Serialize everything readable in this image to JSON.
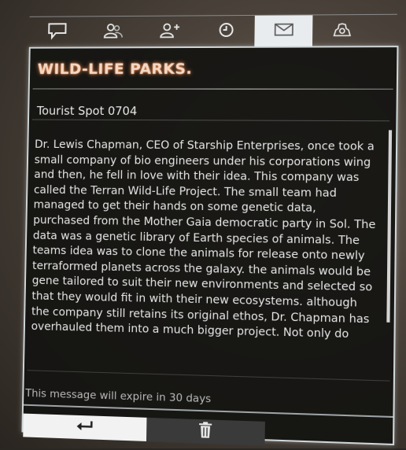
{
  "tabs": [
    {
      "icon": "chat-bubble-icon",
      "active": false
    },
    {
      "icon": "contacts-icon",
      "active": false
    },
    {
      "icon": "add-contact-icon",
      "active": false
    },
    {
      "icon": "clock-icon",
      "active": false
    },
    {
      "icon": "mail-icon",
      "active": true
    },
    {
      "icon": "settings-icon",
      "active": false
    }
  ],
  "message": {
    "title": "WILD-LIFE PARKS.",
    "subject": "Tourist Spot 0704",
    "body": "Dr. Lewis Chapman, CEO of Starship Enterprises, once took a small company of bio engineers under his corporations wing and then, he fell in love with their idea. This company was called the Terran Wild-Life Project. The small team had managed to get their hands on some genetic data, purchased from the Mother Gaia democratic party in Sol. The data was a genetic library of Earth species of animals. The teams idea was to clone the animals for release onto newly terraformed planets across the galaxy. the animals would be gene tailored to suit their new environments and selected so that they would fit in with their new ecosystems. although the company still retains its original ethos, Dr. Chapman has overhauled them into a much bigger project. Not only do",
    "expiry": "This message will expire in 30 days"
  },
  "actions": {
    "reply_icon": "reply-arrow-icon",
    "delete_icon": "trash-icon"
  },
  "colors": {
    "title_glow": "#ff9a60",
    "active_tab": "#e8ecef",
    "window_border": "#cfd6d8"
  }
}
